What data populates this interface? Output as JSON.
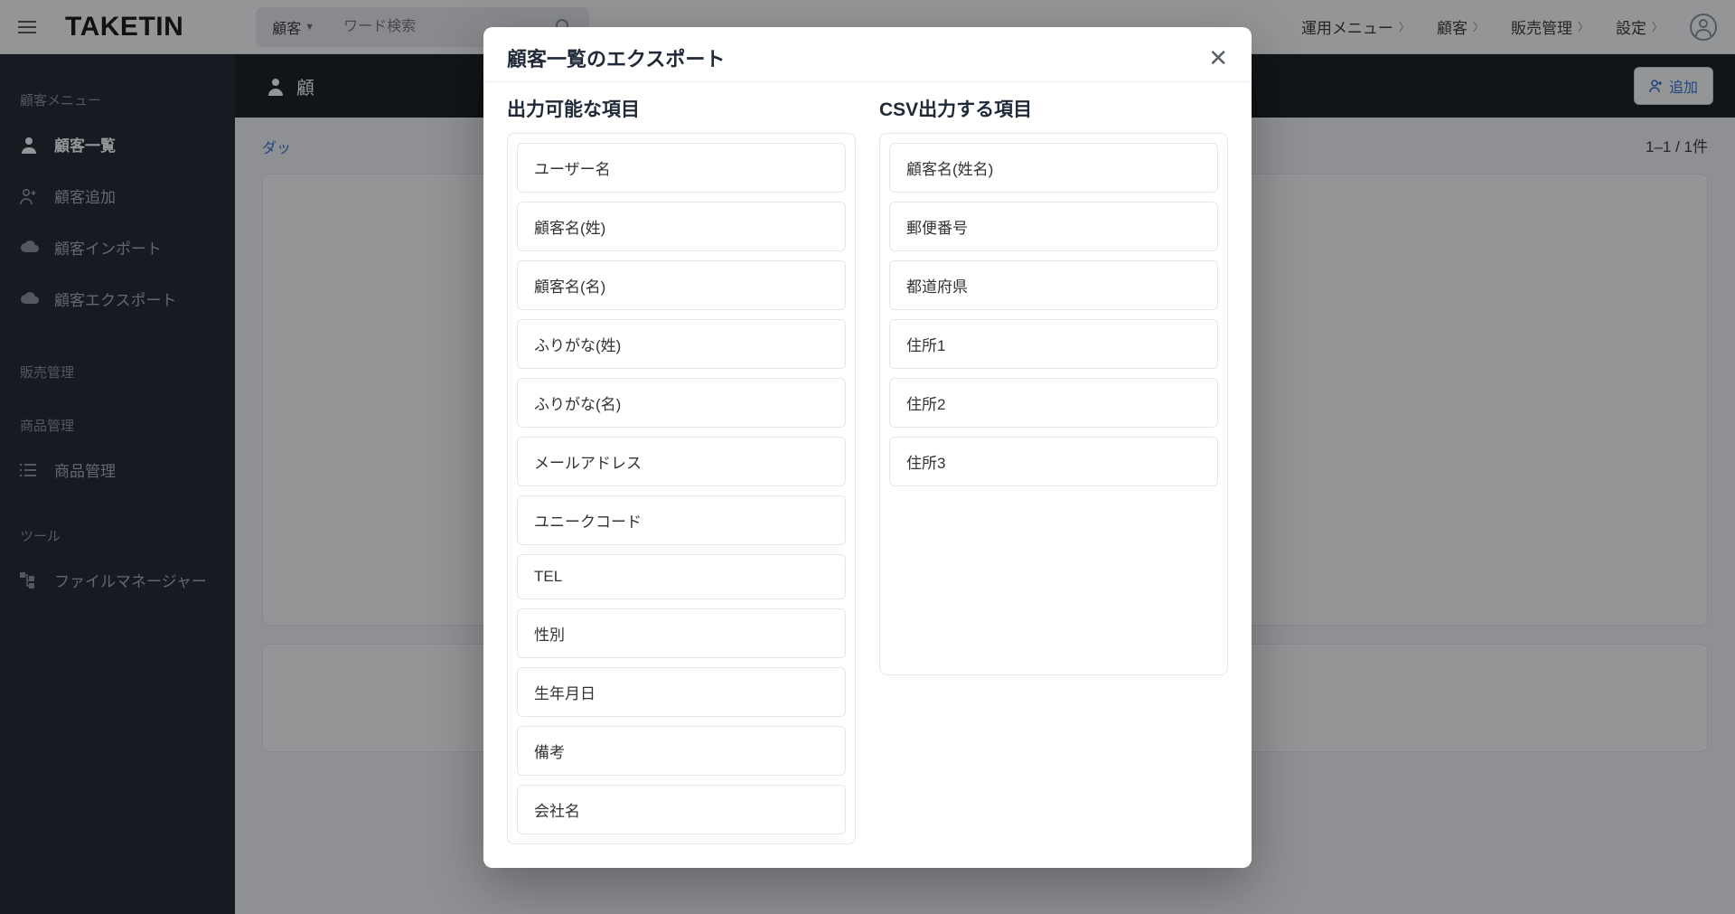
{
  "header": {
    "logo": "TAKETIN",
    "search_category": "顧客",
    "search_placeholder": "ワード検索",
    "nav": [
      "運用メニュー",
      "顧客",
      "販売管理",
      "設定"
    ]
  },
  "subheader": {
    "title": "顧",
    "add_button": "追加"
  },
  "sidebar": {
    "heading_customer": "顧客メニュー",
    "items_customer": [
      "顧客一覧",
      "顧客追加",
      "顧客インポート",
      "顧客エクスポート"
    ],
    "heading_sales": "販売管理",
    "heading_catalog": "商品管理",
    "items_catalog": [
      "商品管理"
    ],
    "heading_tool": "ツール",
    "items_tool": [
      "ファイルマネージャー"
    ]
  },
  "main": {
    "breadcrumb": "ダッ",
    "pager": "1–1 / 1件"
  },
  "modal": {
    "title": "顧客一覧のエクスポート",
    "left_title": "出力可能な項目",
    "right_title": "CSV出力する項目",
    "available": [
      "ユーザー名",
      "顧客名(姓)",
      "顧客名(名)",
      "ふりがな(姓)",
      "ふりがな(名)",
      "メールアドレス",
      "ユニークコード",
      "TEL",
      "性別",
      "生年月日",
      "備考",
      "会社名"
    ],
    "selected": [
      "顧客名(姓名)",
      "郵便番号",
      "都道府県",
      "住所1",
      "住所2",
      "住所3"
    ]
  }
}
